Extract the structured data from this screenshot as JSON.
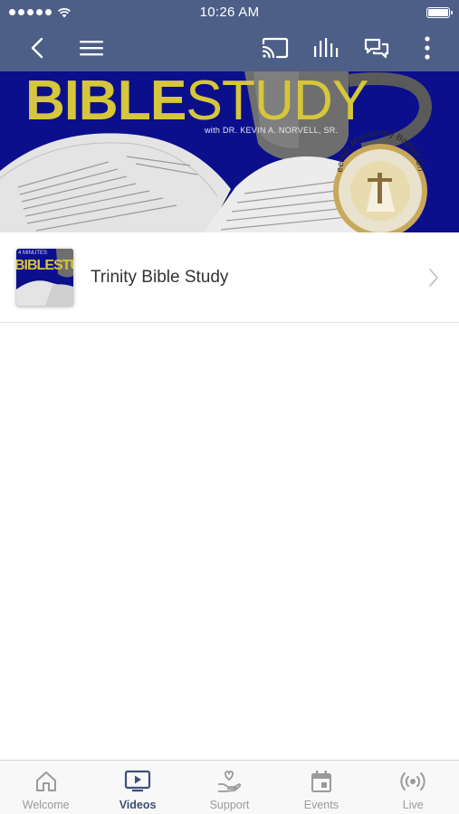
{
  "status_bar": {
    "time": "10:26 AM"
  },
  "nav_bar": {
    "icons": [
      "back-icon",
      "menu-icon",
      "cast-icon",
      "audio-bars-icon",
      "chat-icon",
      "more-vertical-icon"
    ]
  },
  "banner": {
    "title_bold": "BIBLE",
    "title_light": "STUDY",
    "subtitle": "with DR. KEVIN A. NORVELL, SR.",
    "seal_text": "Redeemer Missionary Baptist Church",
    "colors": {
      "background": "#0b0f8c",
      "title": "#d6c63a"
    }
  },
  "list": {
    "items": [
      {
        "title": "Trinity Bible Study",
        "thumbnail_minutes": "4 MINUTES",
        "thumbnail_title": "BIBLESTUDY"
      }
    ]
  },
  "tab_bar": {
    "tabs": [
      {
        "label": "Welcome",
        "icon": "home-icon",
        "active": false
      },
      {
        "label": "Videos",
        "icon": "video-play-icon",
        "active": true
      },
      {
        "label": "Support",
        "icon": "giving-hand-icon",
        "active": false
      },
      {
        "label": "Events",
        "icon": "calendar-icon",
        "active": false
      },
      {
        "label": "Live",
        "icon": "broadcast-icon",
        "active": false
      }
    ],
    "colors": {
      "active": "#3f4f78",
      "inactive": "#9a9a9a"
    }
  },
  "colors": {
    "header": "#4d5f87"
  }
}
